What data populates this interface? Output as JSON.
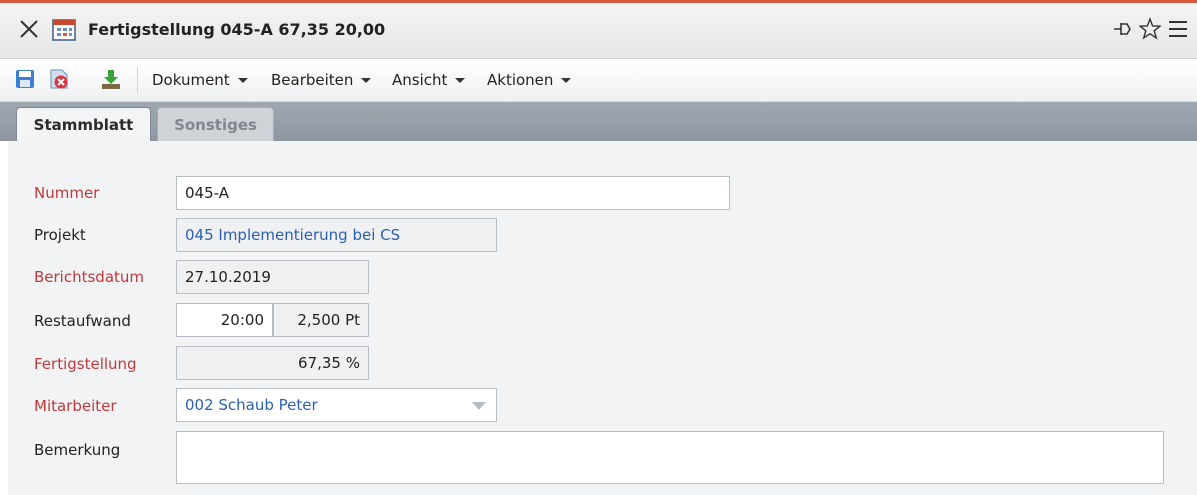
{
  "window": {
    "title": "Fertigstellung 045-A 67,35 20,00",
    "close_icon": "close-icon",
    "doc_icon": "calendar-icon",
    "pin_icon": "pin-icon",
    "star_icon": "star-icon",
    "menu_icon": "hamburger-icon"
  },
  "toolbar": {
    "icons": [
      "save-icon",
      "delete-icon",
      "download-icon"
    ],
    "menus": [
      {
        "label": "Dokument"
      },
      {
        "label": "Bearbeiten"
      },
      {
        "label": "Ansicht"
      },
      {
        "label": "Aktionen"
      }
    ]
  },
  "tabs": [
    {
      "label": "Stammblatt",
      "active": true
    },
    {
      "label": "Sonstiges",
      "active": false
    }
  ],
  "form": {
    "nummer": {
      "label": "Nummer",
      "value": "045-A"
    },
    "projekt": {
      "label": "Projekt",
      "value": "045 Implementierung bei CS"
    },
    "berichtsdatum": {
      "label": "Berichtsdatum",
      "value": "27.10.2019"
    },
    "restaufwand": {
      "label": "Restaufwand",
      "hours": "20:00",
      "days": "2,500 Pt"
    },
    "fertigstellung": {
      "label": "Fertigstellung",
      "value": "67,35 %"
    },
    "mitarbeiter": {
      "label": "Mitarbeiter",
      "value": "002 Schaub Peter"
    },
    "bemerkung": {
      "label": "Bemerkung",
      "value": ""
    }
  },
  "colors": {
    "accent_line": "#d9573b",
    "required_label": "#c0393b",
    "link_value": "#2d5fb3"
  }
}
